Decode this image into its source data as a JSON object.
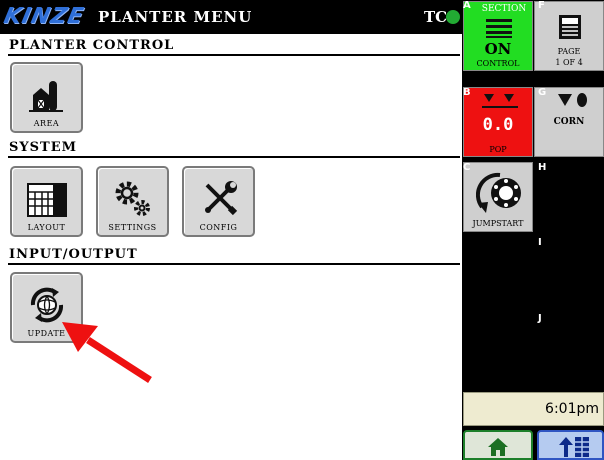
{
  "header": {
    "logo_text": "KINZE",
    "title": "PLANTER MENU",
    "tc_label": "TC",
    "tc_status_color": "#22aa33"
  },
  "sections": {
    "planter_control": "PLANTER CONTROL",
    "system": "SYSTEM",
    "input_output": "INPUT/OUTPUT"
  },
  "tiles": {
    "area": {
      "label": "AREA",
      "icon": "barn-icon"
    },
    "layout": {
      "label": "LAYOUT",
      "icon": "grid-layout-icon"
    },
    "settings": {
      "label": "SETTINGS",
      "icon": "gears-icon"
    },
    "config": {
      "label": "CONFIG",
      "icon": "wrench-screwdriver-icon"
    },
    "update": {
      "label": "UPDATE",
      "icon": "globe-refresh-icon"
    }
  },
  "right_panel": {
    "a": {
      "letter": "A",
      "title": "SECTION",
      "value": "ON",
      "sub": "CONTROL",
      "color": "#22dd22"
    },
    "b": {
      "letter": "B",
      "value": "0.0",
      "sub": "POP",
      "color": "#ee1111"
    },
    "c": {
      "letter": "C",
      "sub": "JUMPSTART"
    },
    "f": {
      "letter": "F",
      "page": "PAGE",
      "page_of": "1 OF 4"
    },
    "g": {
      "letter": "G",
      "sub": "CORN"
    },
    "h": {
      "letter": "H"
    },
    "i": {
      "letter": "I"
    },
    "j": {
      "letter": "J"
    },
    "clock": "6:01pm"
  },
  "annotation": {
    "arrow_color": "#ee1111"
  }
}
